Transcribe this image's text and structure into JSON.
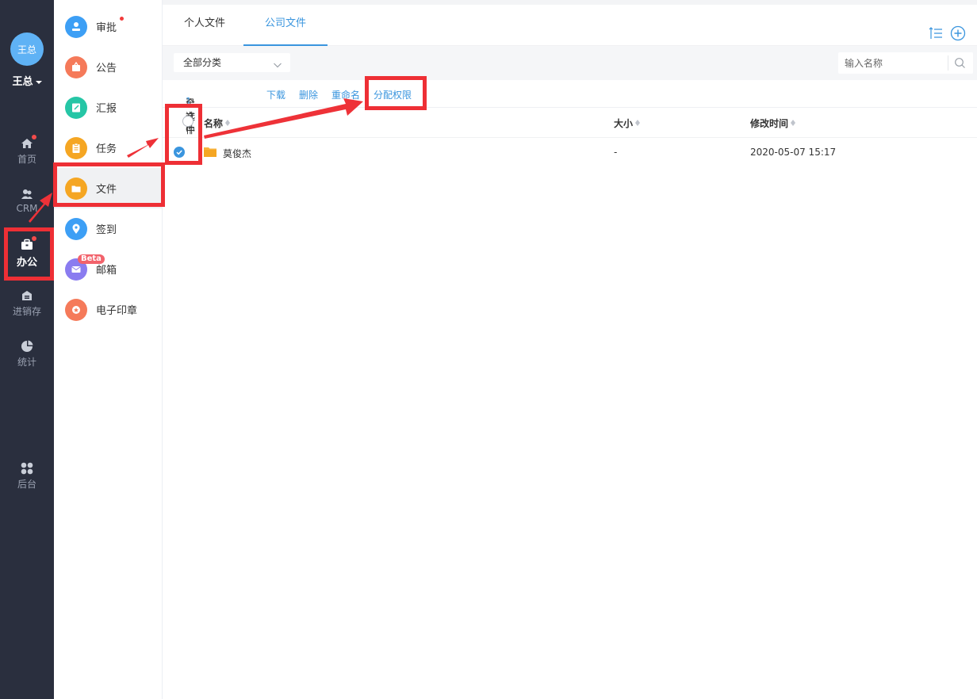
{
  "user": {
    "avatar_text": "王总",
    "name": "王总"
  },
  "rail": {
    "items": [
      {
        "label": "首页",
        "icon": "home-icon",
        "badge": true
      },
      {
        "label": "CRM",
        "icon": "crm-icon",
        "badge": false
      },
      {
        "label": "办公",
        "icon": "office-icon",
        "badge": true,
        "active": true
      },
      {
        "label": "进销存",
        "icon": "inventory-icon",
        "badge": false
      },
      {
        "label": "统计",
        "icon": "pie-chart-icon",
        "badge": false
      },
      {
        "label": "后台",
        "icon": "admin-grid-icon",
        "badge": false
      }
    ]
  },
  "apps": {
    "items": [
      {
        "label": "审批",
        "icon": "approval-icon",
        "color": "#3d9ff5",
        "badge": true
      },
      {
        "label": "公告",
        "icon": "announcement-icon",
        "color": "#f57a5a"
      },
      {
        "label": "汇报",
        "icon": "report-icon",
        "color": "#26c6a6"
      },
      {
        "label": "任务",
        "icon": "task-icon",
        "color": "#f5a623"
      },
      {
        "label": "文件",
        "icon": "folder-icon",
        "color": "#f5a623",
        "active": true
      },
      {
        "label": "签到",
        "icon": "location-pin-icon",
        "color": "#3d9ff5"
      },
      {
        "label": "邮箱",
        "icon": "mail-icon",
        "color": "#8a7cf0",
        "tag": "Beta"
      },
      {
        "label": "电子印章",
        "icon": "seal-icon",
        "color": "#f57a5a"
      }
    ]
  },
  "tabs": [
    {
      "label": "个人文件"
    },
    {
      "label": "公司文件",
      "active": true
    }
  ],
  "filter": {
    "category": "全部分类",
    "search_placeholder": "输入名称"
  },
  "actions": {
    "selected_prefix": "已选中",
    "selected_count": "1",
    "selected_suffix": "个文件",
    "download": "下载",
    "delete": "删除",
    "rename": "重命名",
    "assign_permission": "分配权限"
  },
  "table": {
    "columns": {
      "name": "名称",
      "size": "大小",
      "modified": "修改时间"
    },
    "rows": [
      {
        "name": "莫俊杰",
        "size": "-",
        "modified": "2020-05-07 15:17",
        "checked": true
      }
    ]
  },
  "colors": {
    "accent": "#3a95de",
    "rail_bg": "#2a2f3e",
    "highlight": "#ee2f35"
  }
}
